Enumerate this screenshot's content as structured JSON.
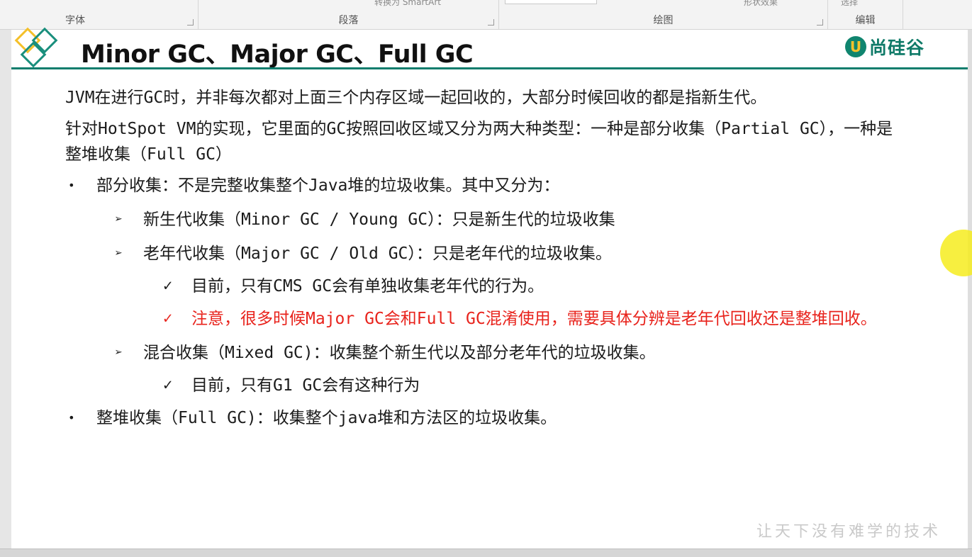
{
  "ribbon": {
    "groups": [
      {
        "label": "字体"
      },
      {
        "label": "段落"
      },
      {
        "label": "绘图"
      },
      {
        "label": "编辑"
      }
    ],
    "cut_text_left": "转换为 SmartArt",
    "cut_text_right": "形状效果",
    "cut_text_edit": "选择"
  },
  "slide": {
    "title": "Minor GC、Major GC、Full GC",
    "logo_mark": "U",
    "logo_text": "尚硅谷",
    "paragraphs": [
      "JVM在进行GC时，并非每次都对上面三个内存区域一起回收的，大部分时候回收的都是指新生代。",
      "针对HotSpot VM的实现，它里面的GC按照回收区域又分为两大种类型：一种是部分收集（Partial GC），一种是整堆收集（Full GC）"
    ],
    "bullets": {
      "partial": "部分收集：不是完整收集整个Java堆的垃圾收集。其中又分为：",
      "minor": "新生代收集（Minor GC / Young GC）：只是新生代的垃圾收集",
      "major": "老年代收集（Major GC / Old GC）：只是老年代的垃圾收集。",
      "major_note1": "目前，只有CMS GC会有单独收集老年代的行为。",
      "major_note2": "注意，很多时候Major GC会和Full GC混淆使用，需要具体分辨是老年代回收还是整堆回收。",
      "mixed": "混合收集（Mixed GC)：收集整个新生代以及部分老年代的垃圾收集。",
      "mixed_note": "目前，只有G1 GC会有这种行为",
      "full": "整堆收集（Full GC)：收集整个java堆和方法区的垃圾收集。"
    },
    "marks": {
      "bullet": "•",
      "arrow": "➢",
      "check": "✓"
    },
    "watermark": "让天下没有难学的技术"
  },
  "colors": {
    "accent_teal": "#0d7d6d",
    "accent_yellow": "#f4c02a",
    "warning_red": "#e8231c"
  }
}
